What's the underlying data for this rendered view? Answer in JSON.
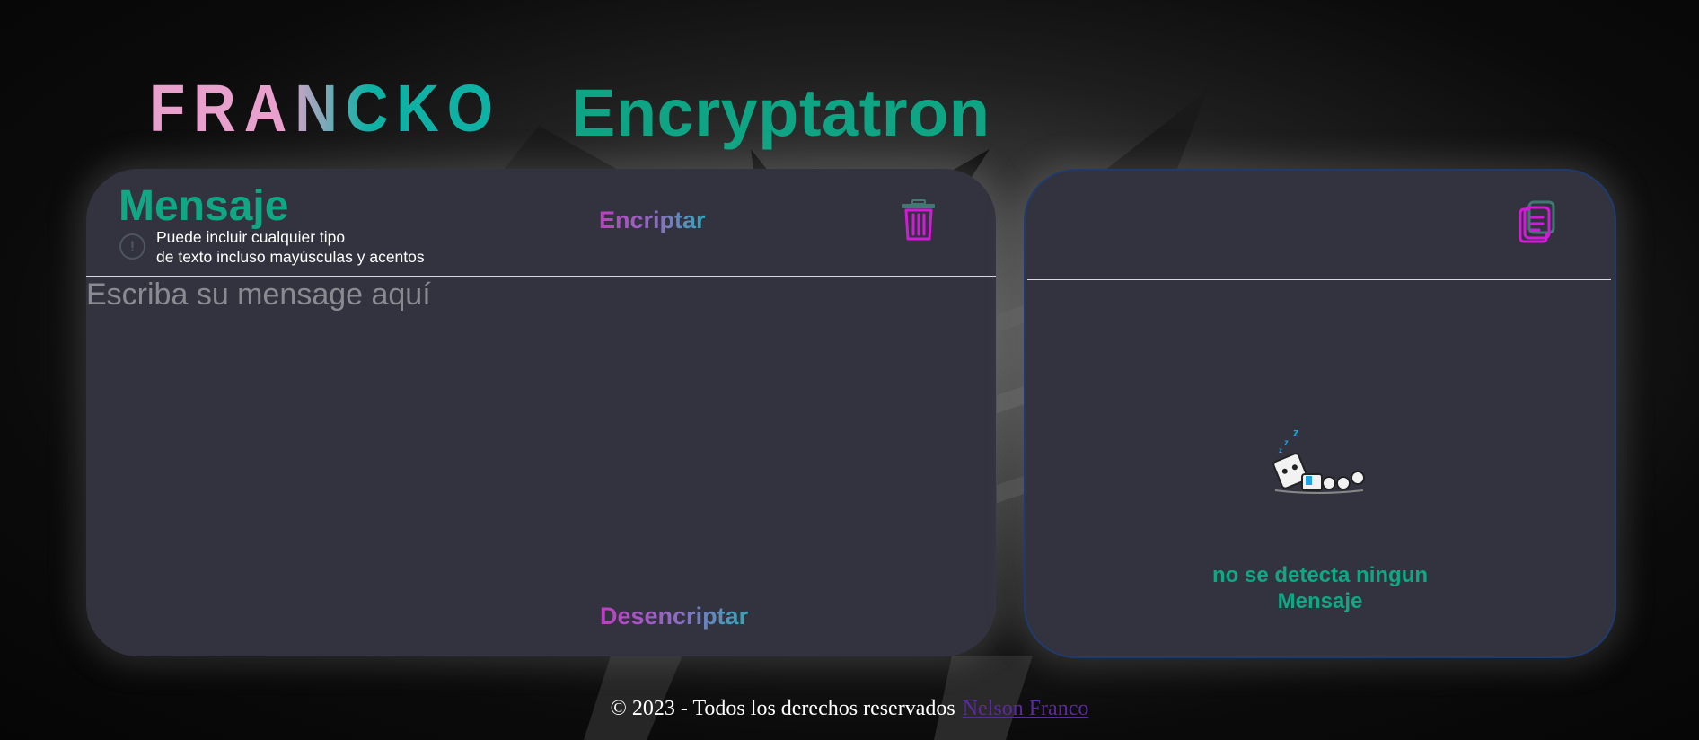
{
  "header": {
    "logo_text": "FRANCKO",
    "app_title": "Encryptatron"
  },
  "input_panel": {
    "title": "Mensaje",
    "info_icon": "exclamation-circle-icon",
    "info_line1": "Puede incluir cualquier tipo",
    "info_line2": "de texto incluso mayúsculas y acentos",
    "encrypt_label": "Encriptar",
    "decrypt_label": "Desencriptar",
    "clear_icon": "trash-icon",
    "textarea_placeholder": "Escriba su mensage aquí",
    "textarea_value": ""
  },
  "output_panel": {
    "copy_icon": "copy-icon",
    "illustration": "sleeping-robot-icon",
    "empty_line1": "no se detecta ningun",
    "empty_line2": "Mensaje"
  },
  "footer": {
    "text": "© 2023 - Todos los derechos reservados",
    "link_text": "Nelson Franco"
  },
  "colors": {
    "accent_green": "#10a784",
    "panel_bg": "#333340",
    "icon_magenta": "#d21bd6",
    "logo_pink": "#e8a1cc",
    "logo_teal": "#10b1a5",
    "link_purple": "#5b2aa0"
  }
}
